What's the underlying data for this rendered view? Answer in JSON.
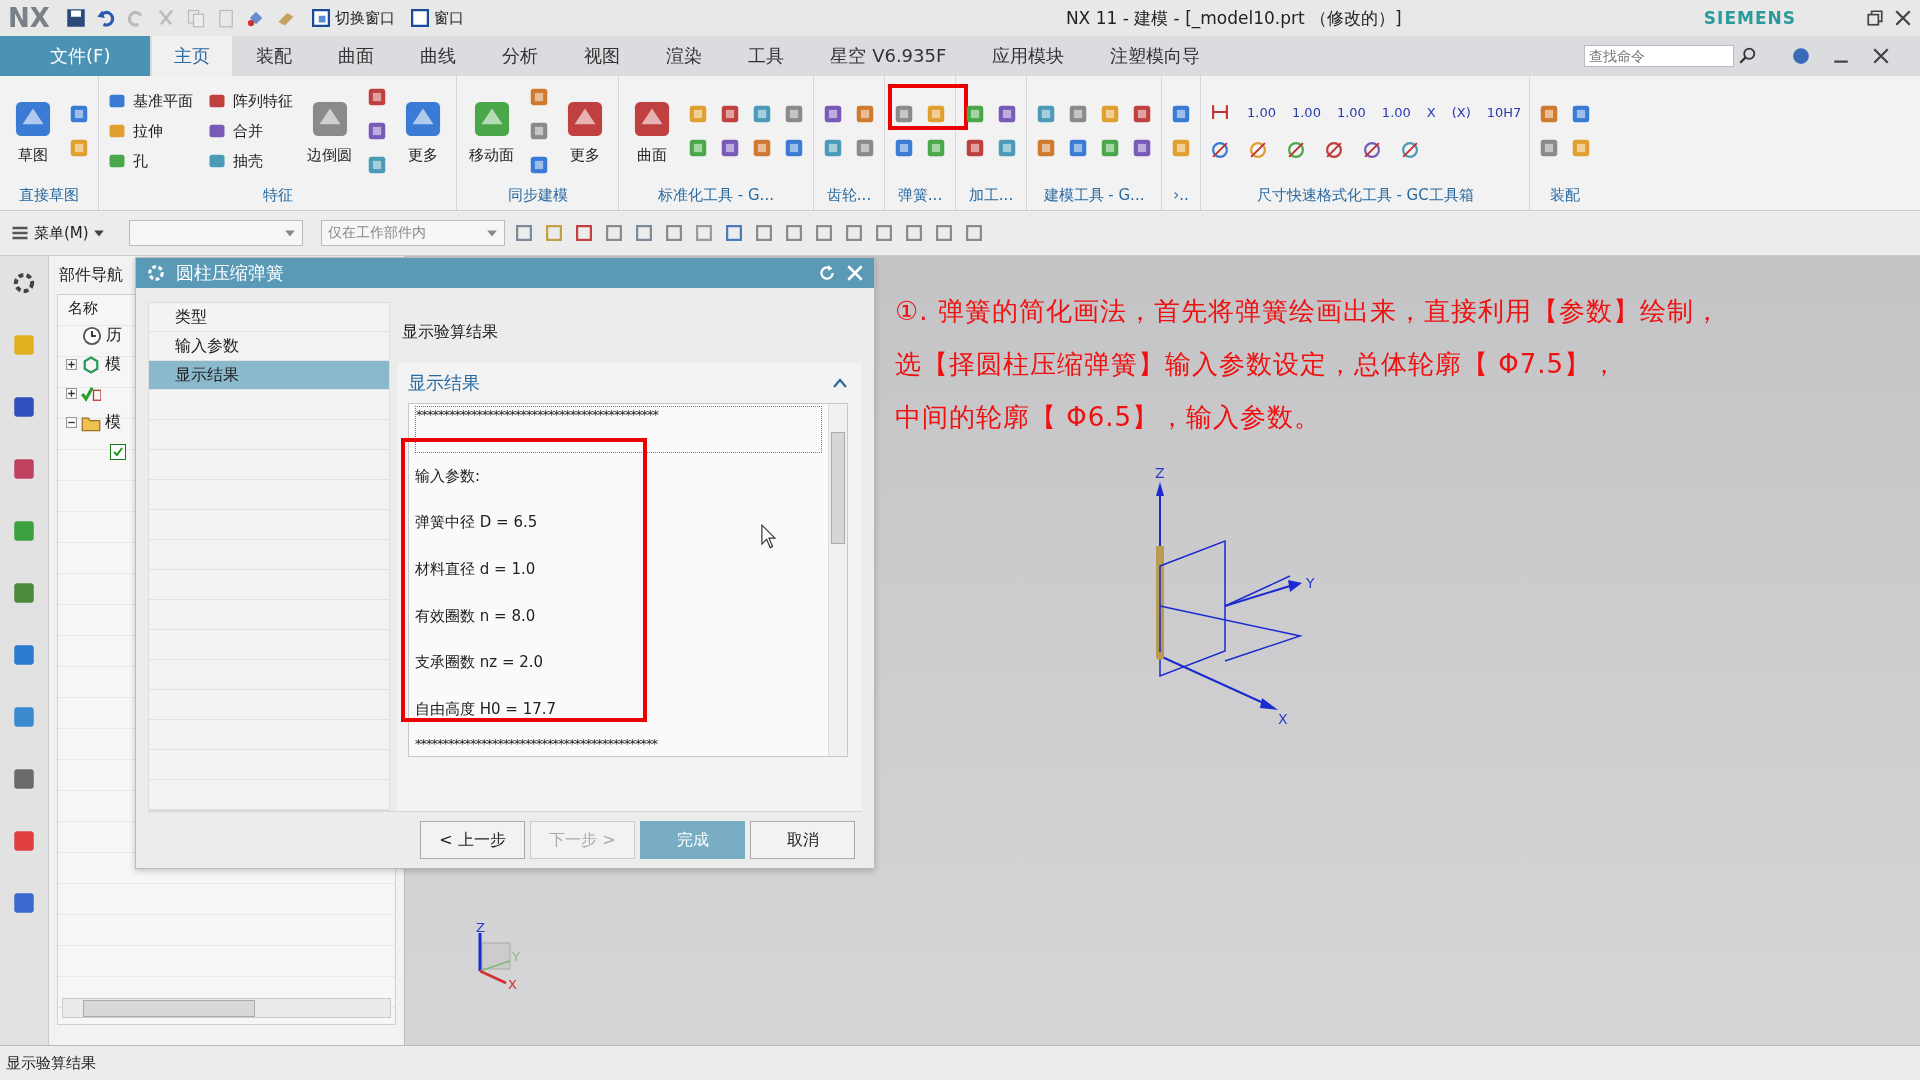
{
  "title_bar": {
    "logo": "NX",
    "quick_buttons": [
      "切换窗口",
      "窗口"
    ],
    "title": "NX 11 - 建模 - [_model10.prt （修改的）]",
    "brand": "SIEMENS"
  },
  "menu_tabs": [
    {
      "label": "文件(F)",
      "kind": "file",
      "selected": false
    },
    {
      "label": "主页",
      "kind": "tab",
      "selected": true
    },
    {
      "label": "装配",
      "kind": "tab",
      "selected": false
    },
    {
      "label": "曲面",
      "kind": "tab",
      "selected": false
    },
    {
      "label": "曲线",
      "kind": "tab",
      "selected": false
    },
    {
      "label": "分析",
      "kind": "tab",
      "selected": false
    },
    {
      "label": "视图",
      "kind": "tab",
      "selected": false
    },
    {
      "label": "渲染",
      "kind": "tab",
      "selected": false
    },
    {
      "label": "工具",
      "kind": "tab",
      "selected": false
    },
    {
      "label": "星空 V6.935F",
      "kind": "tab",
      "selected": false
    },
    {
      "label": "应用模块",
      "kind": "tab",
      "selected": false
    },
    {
      "label": "注塑模向导",
      "kind": "tab",
      "selected": false
    }
  ],
  "search": {
    "placeholder": "查找命令"
  },
  "ribbon_groups": [
    {
      "label": "直接草图",
      "tools": [
        {
          "label": "草图",
          "kind": "large"
        }
      ]
    },
    {
      "label": "特征",
      "tools": [
        {
          "label": "基准平面",
          "kind": "small"
        },
        {
          "label": "拉伸",
          "kind": "small"
        },
        {
          "label": "孔",
          "kind": "small"
        },
        {
          "label": "阵列特征",
          "kind": "small"
        },
        {
          "label": "合并",
          "kind": "small"
        },
        {
          "label": "抽壳",
          "kind": "small"
        },
        {
          "label": "边倒圆",
          "kind": "large"
        },
        {
          "label": "更多",
          "kind": "large"
        }
      ]
    },
    {
      "label": "同步建模",
      "tools": [
        {
          "label": "移动面",
          "kind": "large"
        },
        {
          "label": "更多",
          "kind": "large"
        }
      ]
    },
    {
      "label": "标准化工具 - G...",
      "tools": [
        {
          "label": "曲面",
          "kind": "large"
        }
      ]
    },
    {
      "label": "齿轮..."
    },
    {
      "label": "弹簧..."
    },
    {
      "label": "加工..."
    },
    {
      "label": "建模工具 - G..."
    },
    {
      "label": "›.."
    },
    {
      "label": "尺寸快速格式化工具 - GC工具箱",
      "tools": [
        {
          "label": "1.00",
          "kind": "text"
        },
        {
          "label": "1.00",
          "kind": "text"
        },
        {
          "label": "1.00",
          "kind": "text"
        },
        {
          "label": "1.00",
          "kind": "text"
        },
        {
          "label": "X",
          "kind": "text"
        },
        {
          "label": "(X)",
          "kind": "text"
        },
        {
          "label": "10H7",
          "kind": "text"
        }
      ]
    },
    {
      "label": "装配"
    }
  ],
  "toolbar": {
    "menu": "菜单(M)",
    "filter_value": "仅在工作部件内"
  },
  "navigator": {
    "title": "部件导航",
    "column": "名称",
    "tree": [
      {
        "kind": "history",
        "label": "历"
      },
      {
        "kind": "model",
        "label": "模",
        "expanded": false
      },
      {
        "kind": "constraint",
        "expanded": false
      },
      {
        "kind": "folder",
        "label": "模",
        "expanded": true,
        "children": [
          {
            "kind": "checkbox",
            "checked": true
          }
        ]
      }
    ]
  },
  "dialog": {
    "title": "圆柱压缩弹簧",
    "steps": [
      {
        "label": "类型",
        "selected": false
      },
      {
        "label": "输入参数",
        "selected": false
      },
      {
        "label": "显示结果",
        "selected": true
      }
    ],
    "caption": "显示验算结果",
    "section": "显示结果",
    "section_expanded": true,
    "result_lines": [
      "********************************************",
      "输入参数:",
      "弹簧中径 D = 6.5",
      "材料直径 d = 1.0",
      "有效圈数 n = 8.0",
      "支承圈数 nz = 2.0",
      "自由高度 H0 = 17.7",
      "********************************************"
    ],
    "buttons": [
      {
        "label": "< 上一步",
        "kind": "normal",
        "disabled": false
      },
      {
        "label": "下一步 >",
        "kind": "normal",
        "disabled": true
      },
      {
        "label": "完成",
        "kind": "primary",
        "disabled": false
      },
      {
        "label": "取消",
        "kind": "normal",
        "disabled": false
      }
    ]
  },
  "annotation": [
    "①. 弹簧的简化画法，首先将弹簧绘画出来，直接利用【参数】绘制，",
    "选【择圆柱压缩弹簧】输入参数设定，总体轮廓【 Φ7.5】，",
    "中间的轮廓【 Φ6.5】，输入参数。"
  ],
  "viewport": {
    "axis_labels": [
      "Z",
      "Y",
      "X"
    ],
    "triad_labels": [
      "Z",
      "Y",
      "X"
    ]
  },
  "status_bar": "显示验算结果"
}
